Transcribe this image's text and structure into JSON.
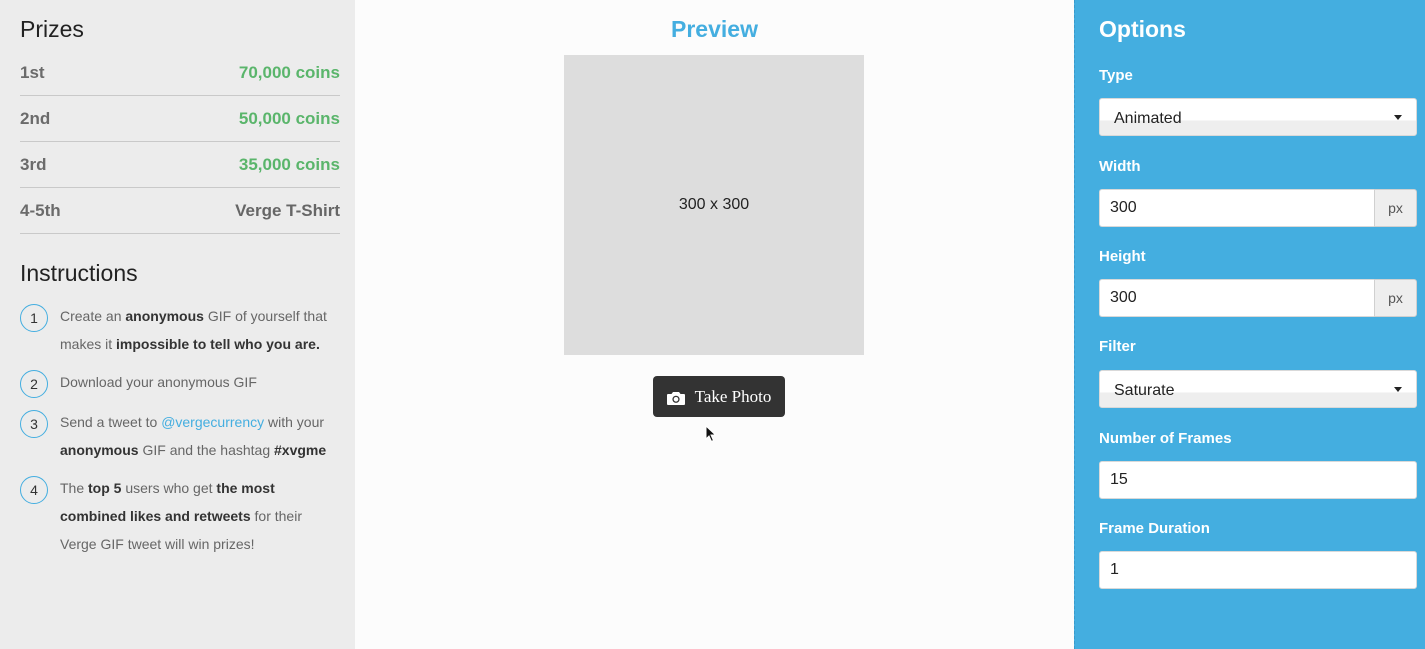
{
  "prizes": {
    "title": "Prizes",
    "items": [
      {
        "rank": "1st",
        "prize": "70,000 coins"
      },
      {
        "rank": "2nd",
        "prize": "50,000 coins"
      },
      {
        "rank": "3rd",
        "prize": "35,000 coins"
      },
      {
        "rank": "4-5th",
        "prize": "Verge T-Shirt"
      }
    ]
  },
  "instructions": {
    "title": "Instructions",
    "steps": [
      {
        "num": "1",
        "parts": [
          "Create an ",
          "anonymous",
          " GIF of yourself that makes it ",
          "impossible to tell who you are."
        ]
      },
      {
        "num": "2",
        "parts": [
          "Download your anonymous GIF"
        ]
      },
      {
        "num": "3",
        "parts": [
          "Send a tweet to ",
          "@vergecurrency",
          " with your ",
          "anonymous",
          " GIF and the hashtag ",
          "#xvgme"
        ]
      },
      {
        "num": "4",
        "parts": [
          "The ",
          "top 5",
          " users who get ",
          "the most combined likes and retweets",
          " for their Verge GIF tweet will win prizes!"
        ]
      }
    ]
  },
  "preview": {
    "title": "Preview",
    "placeholder": "300 x 300",
    "button_label": "Take Photo"
  },
  "options": {
    "title": "Options",
    "type_label": "Type",
    "type_value": "Animated",
    "width_label": "Width",
    "width_value": "300",
    "width_unit": "px",
    "height_label": "Height",
    "height_value": "300",
    "height_unit": "px",
    "filter_label": "Filter",
    "filter_value": "Saturate",
    "frames_label": "Number of Frames",
    "frames_value": "15",
    "duration_label": "Frame Duration",
    "duration_value": "1"
  },
  "colors": {
    "accent": "#44aee0",
    "prize_green": "#5ab56b",
    "button_dark": "#333333"
  }
}
